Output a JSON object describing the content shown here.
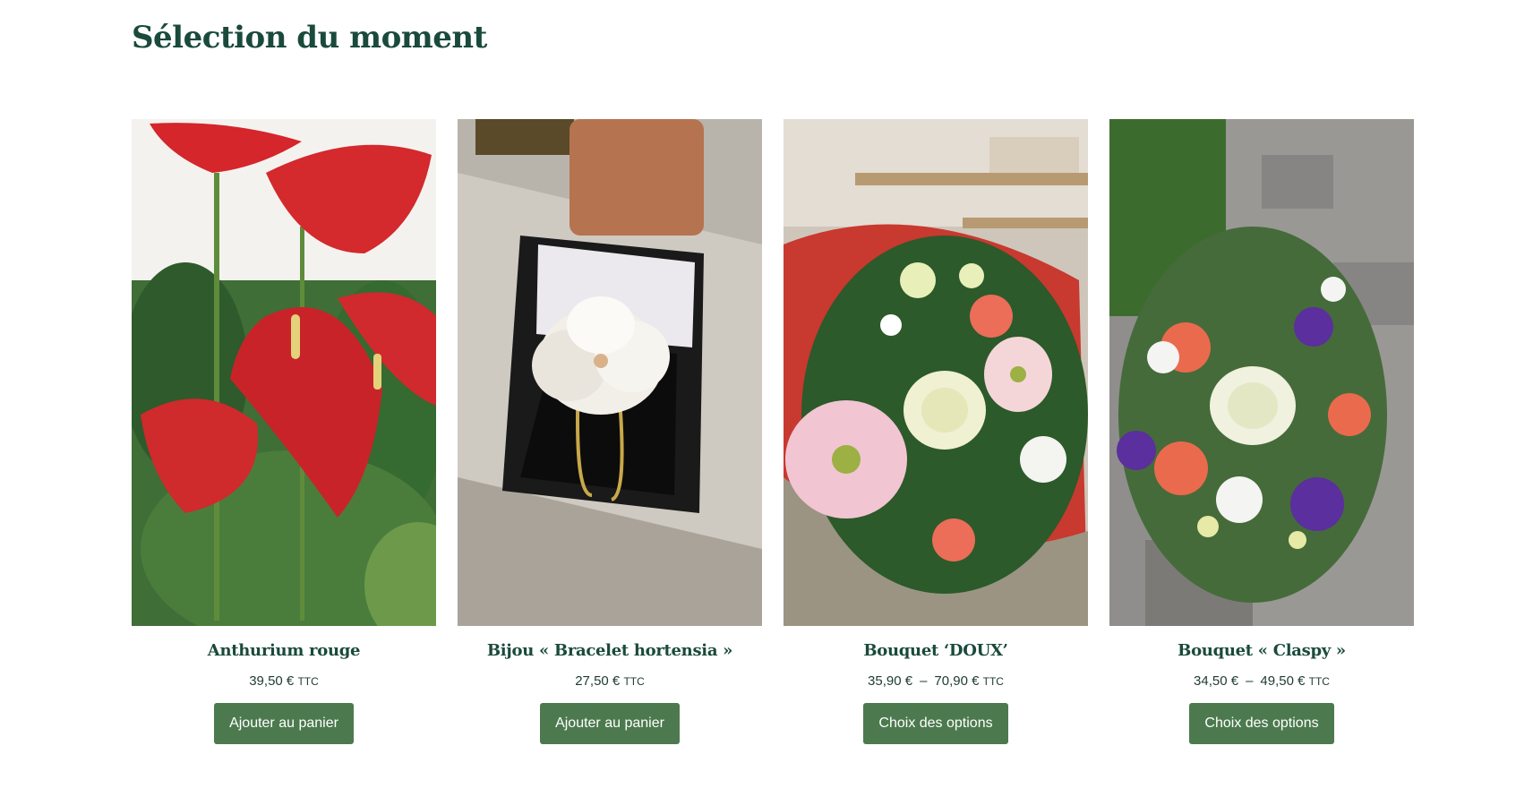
{
  "colors": {
    "heading": "#1a4a3c",
    "text": "#1f3a32",
    "button": "#4c7a4e"
  },
  "section": {
    "title": "Sélection du moment"
  },
  "products": [
    {
      "name": "Anthurium rouge",
      "price": "39,50 €",
      "price_max": "",
      "tax": "TTC",
      "button": "Ajouter au panier"
    },
    {
      "name": "Bijou « Bracelet hortensia »",
      "price": "27,50 €",
      "price_max": "",
      "tax": "TTC",
      "button": "Ajouter au panier"
    },
    {
      "name": "Bouquet ‘DOUX’",
      "price": "35,90 €",
      "price_max": "70,90 €",
      "tax": "TTC",
      "button": "Choix des options"
    },
    {
      "name": "Bouquet « Claspy »",
      "price": "34,50 €",
      "price_max": "49,50 €",
      "tax": "TTC",
      "button": "Choix des options"
    }
  ]
}
